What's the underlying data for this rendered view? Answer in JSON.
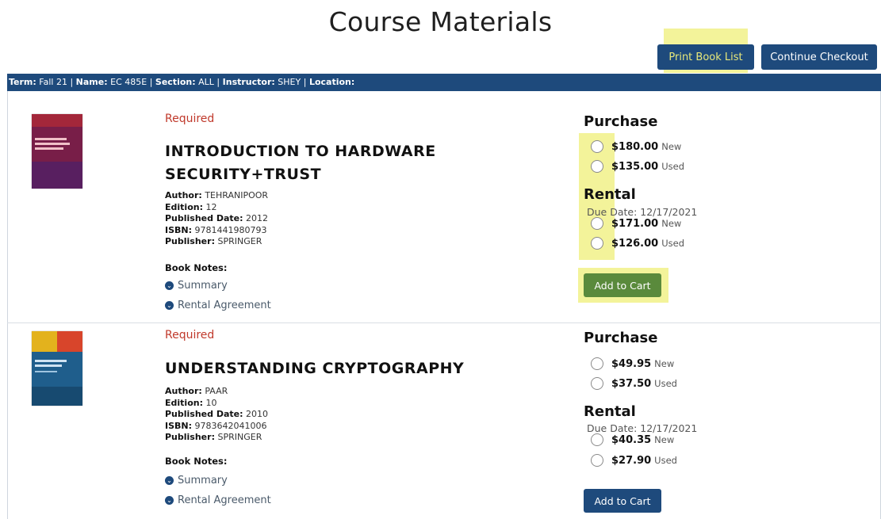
{
  "page": {
    "title": "Course Materials"
  },
  "toolbar": {
    "print_label": "Print Book List",
    "checkout_label": "Continue Checkout"
  },
  "info_bar": {
    "term_label": "Term:",
    "term": "Fall 21",
    "name_label": "Name:",
    "name": "EC 485E",
    "section_label": "Section:",
    "section": "ALL",
    "instructor_label": "Instructor:",
    "instructor": "SHEY",
    "location_label": "Location:",
    "location": ""
  },
  "labels": {
    "author": "Author:",
    "edition": "Edition:",
    "published": "Published Date:",
    "isbn": "ISBN:",
    "publisher": "Publisher:",
    "notes": "Book Notes:",
    "summary": "Summary",
    "rental_agreement": "Rental Agreement",
    "purchase": "Purchase",
    "rental": "Rental",
    "add_to_cart": "Add to Cart"
  },
  "books": [
    {
      "status": "Required",
      "title_line1": "INTRODUCTION TO HARDWARE",
      "title_line2": "SECURITY+TRUST",
      "author": "TEHRANIPOOR",
      "edition": "12",
      "published": "2012",
      "isbn": "9781441980793",
      "publisher": "SPRINGER",
      "purchase": [
        {
          "price": "$180.00",
          "cond": "New"
        },
        {
          "price": "$135.00",
          "cond": "Used"
        }
      ],
      "due_date": "Due Date: 12/17/2021",
      "rental": [
        {
          "price": "$171.00",
          "cond": "New"
        },
        {
          "price": "$126.00",
          "cond": "Used"
        }
      ],
      "cart_color": "#5a8a3c"
    },
    {
      "status": "Required",
      "title_line1": "UNDERSTANDING CRYPTOGRAPHY",
      "title_line2": "",
      "author": "PAAR",
      "edition": "10",
      "published": "2010",
      "isbn": "9783642041006",
      "publisher": "SPRINGER",
      "purchase": [
        {
          "price": "$49.95",
          "cond": "New"
        },
        {
          "price": "$37.50",
          "cond": "Used"
        }
      ],
      "due_date": "Due Date: 12/17/2021",
      "rental": [
        {
          "price": "$40.35",
          "cond": "New"
        },
        {
          "price": "$27.90",
          "cond": "Used"
        }
      ],
      "cart_color": "#1e4a7c"
    }
  ],
  "colors": {
    "brand": "#1e4a7c",
    "required": "#c0392b",
    "highlight": "#f3f39a"
  }
}
